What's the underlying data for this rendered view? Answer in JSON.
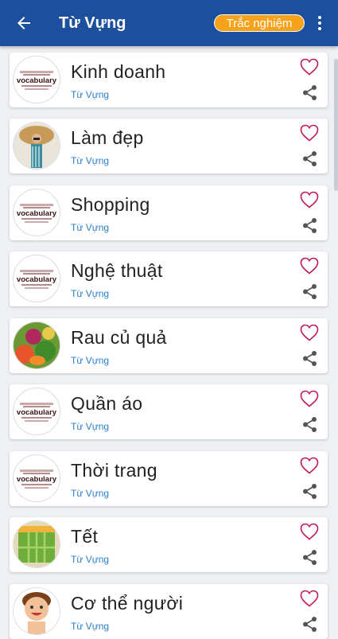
{
  "appbar": {
    "title": "Từ Vựng",
    "quiz_label": "Trắc nghiệm"
  },
  "items": [
    {
      "name": "Kinh doanh",
      "sub": "Từ Vựng",
      "thumb": "vocabulary"
    },
    {
      "name": "Làm đẹp",
      "sub": "Từ Vựng",
      "thumb": "woman-hat"
    },
    {
      "name": "Shopping",
      "sub": "Từ Vựng",
      "thumb": "vocabulary"
    },
    {
      "name": "Nghệ thuật",
      "sub": "Từ Vựng",
      "thumb": "vocabulary"
    },
    {
      "name": "Rau củ quả",
      "sub": "Từ Vựng",
      "thumb": "vegetables"
    },
    {
      "name": "Quần áo",
      "sub": "Từ Vựng",
      "thumb": "vocabulary"
    },
    {
      "name": "Thời trang",
      "sub": "Từ Vựng",
      "thumb": "vocabulary"
    },
    {
      "name": "Tết",
      "sub": "Từ Vựng",
      "thumb": "banh-chung"
    },
    {
      "name": "Cơ thể người",
      "sub": "Từ Vựng",
      "thumb": "cartoon-boy"
    }
  ],
  "colors": {
    "appbar": "#1c4f9c",
    "quiz_button": "#f7a21b",
    "heart": "#c2185b",
    "subtitle": "#2a7fcc"
  }
}
